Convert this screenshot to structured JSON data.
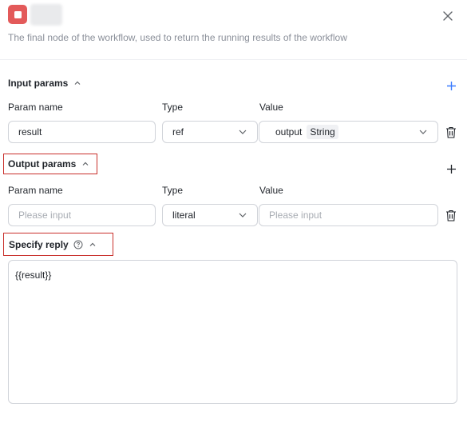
{
  "header": {
    "icon": "stop-square-icon",
    "accent_color": "#e35a5a",
    "description": "The final node of the workflow, used to return the running results of the workflow"
  },
  "input_params": {
    "title": "Input params",
    "columns": {
      "name": "Param name",
      "type": "Type",
      "value": "Value"
    },
    "rows": [
      {
        "name": "result",
        "type": "ref",
        "value_ref": "output",
        "value_type": "String"
      }
    ]
  },
  "output_params": {
    "title": "Output params",
    "columns": {
      "name": "Param name",
      "type": "Type",
      "value": "Value"
    },
    "rows": [
      {
        "name_placeholder": "Please input",
        "type": "literal",
        "value_placeholder": "Please input"
      }
    ]
  },
  "specify_reply": {
    "title": "Specify reply",
    "content": "{{result}}"
  },
  "colors": {
    "highlight_border": "#c9302c",
    "add_icon_blue": "#3b7cff"
  }
}
